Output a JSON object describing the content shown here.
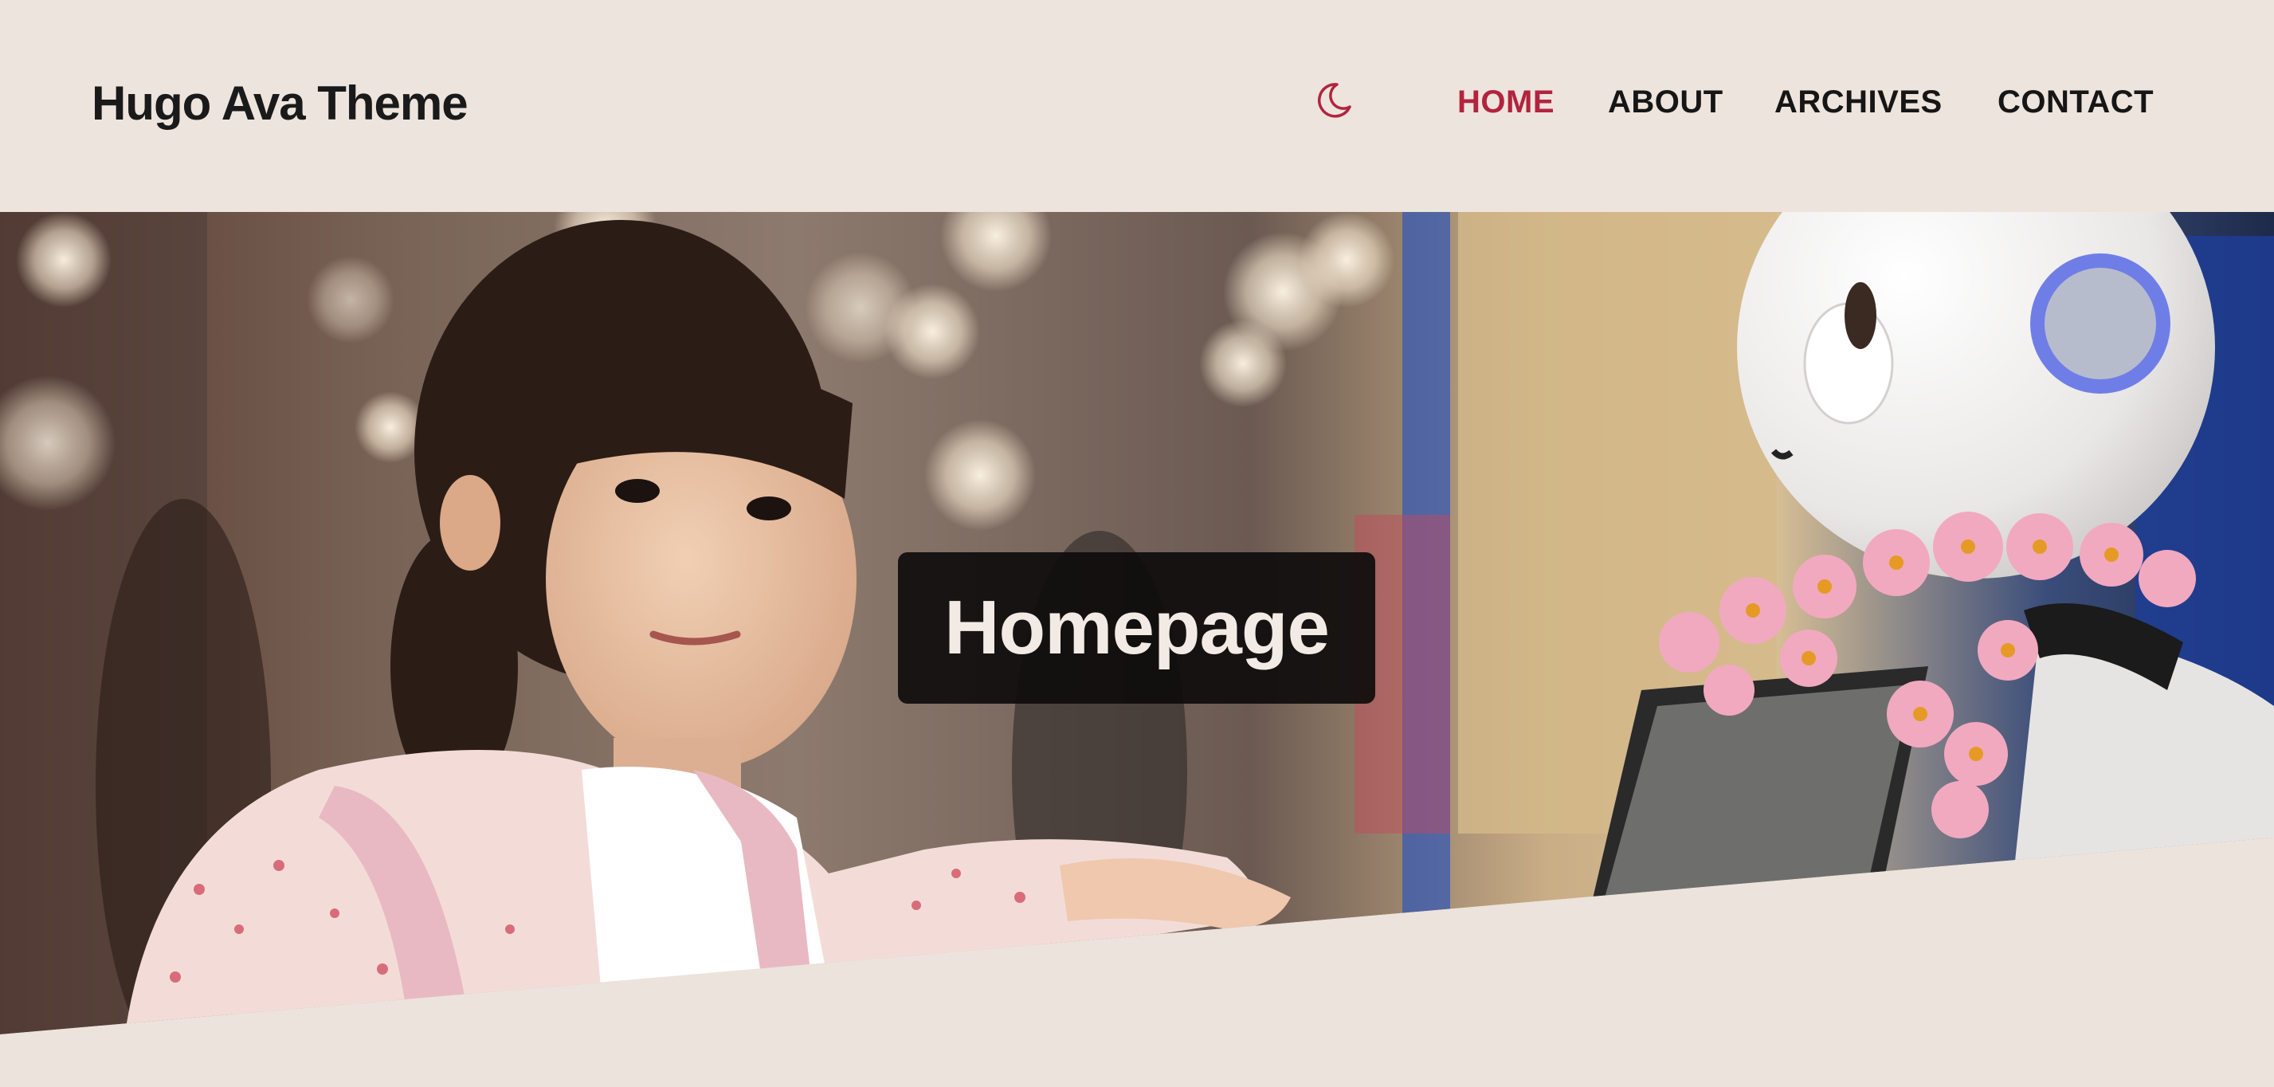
{
  "header": {
    "site_title": "Hugo Ava Theme",
    "theme_toggle_icon": "moon-icon",
    "nav": {
      "home": "HOME",
      "about": "ABOUT",
      "archives": "ARCHIVES",
      "contact": "CONTACT"
    }
  },
  "hero": {
    "title": "Homepage",
    "image_subject": "girl-and-robot-photo"
  },
  "colors": {
    "background": "#ece3dc",
    "accent": "#b2243e",
    "text": "#161616"
  }
}
